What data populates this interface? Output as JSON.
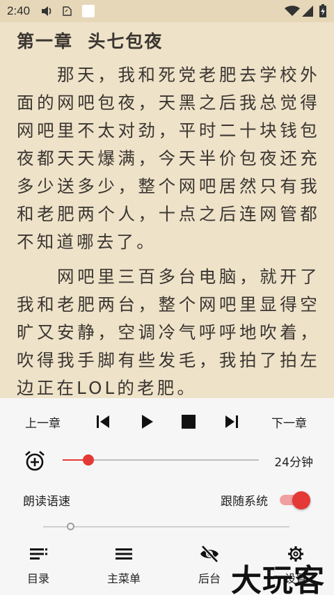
{
  "status_bar": {
    "time": "2:40",
    "icons": [
      "volume-icon",
      "sim-icon",
      "notification-square-icon",
      "wifi-icon",
      "signal-icon",
      "battery-charging-icon"
    ]
  },
  "reader": {
    "chapter_title": "第一章  头七包夜",
    "paragraphs": [
      "那天，我和死党老肥去学校外面的网吧包夜，天黑之后我总觉得网吧里不太对劲，平时二十块钱包夜都天天爆满，今天半价包夜还充多少送多少，整个网吧居然只有我和老肥两个人，十点之后连网管都不知道哪去了。",
      "网吧里三百多台电脑，就开了我和老肥两台，整个网吧里显得空旷又安静，空调冷气呼呼地吹着，吹得我手脚有些发毛，我拍了拍左边正在LOL的老肥。"
    ]
  },
  "tts_panel": {
    "prev_chapter": "上一章",
    "next_chapter": "下一章",
    "controls": [
      "skip-previous-icon",
      "play-icon",
      "stop-icon",
      "skip-next-icon"
    ],
    "timer": {
      "value": "24分钟",
      "fraction": 0.13
    },
    "speed_label": "朗读语速",
    "follow_system_label": "跟随系统",
    "follow_system_on": true,
    "speed_fraction": 0.11
  },
  "bottom_nav": [
    {
      "label": "目录",
      "icon": "toc-list-icon"
    },
    {
      "label": "主菜单",
      "icon": "menu-icon"
    },
    {
      "label": "后台",
      "icon": "eye-off-icon"
    },
    {
      "label": "设置",
      "icon": "gear-icon"
    }
  ],
  "watermark": "大玩客",
  "colors": {
    "page_background": "#eee2c9",
    "status_bar": "#e6d7b8",
    "panel_background": "#f6f6f6",
    "accent": "#e53935",
    "text": "#3a3530"
  }
}
